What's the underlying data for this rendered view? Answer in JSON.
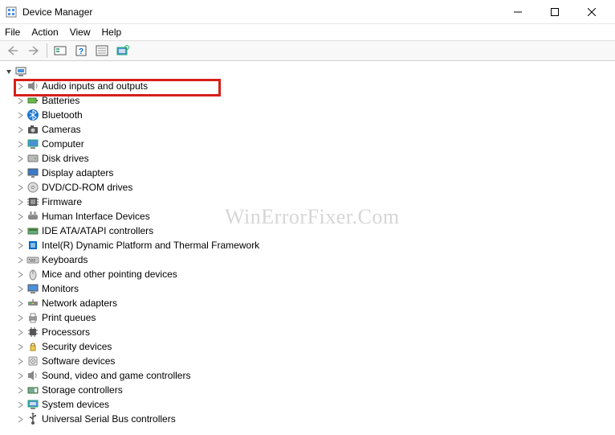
{
  "window": {
    "title": "Device Manager"
  },
  "menu": {
    "file": "File",
    "action": "Action",
    "view": "View",
    "help": "Help"
  },
  "toolbar": {
    "back": "back-icon",
    "forward": "forward-icon",
    "show_hidden": "show-hidden-icon",
    "help": "help-icon",
    "properties": "properties-icon",
    "scan": "scan-icon"
  },
  "root": {
    "label": ""
  },
  "categories": [
    {
      "label": "Audio inputs and outputs",
      "icon": "audio"
    },
    {
      "label": "Batteries",
      "icon": "battery"
    },
    {
      "label": "Bluetooth",
      "icon": "bluetooth"
    },
    {
      "label": "Cameras",
      "icon": "camera"
    },
    {
      "label": "Computer",
      "icon": "computer"
    },
    {
      "label": "Disk drives",
      "icon": "disk"
    },
    {
      "label": "Display adapters",
      "icon": "display"
    },
    {
      "label": "DVD/CD-ROM drives",
      "icon": "dvd"
    },
    {
      "label": "Firmware",
      "icon": "firmware"
    },
    {
      "label": "Human Interface Devices",
      "icon": "hid"
    },
    {
      "label": "IDE ATA/ATAPI controllers",
      "icon": "ide"
    },
    {
      "label": "Intel(R) Dynamic Platform and Thermal Framework",
      "icon": "intel"
    },
    {
      "label": "Keyboards",
      "icon": "keyboard"
    },
    {
      "label": "Mice and other pointing devices",
      "icon": "mouse"
    },
    {
      "label": "Monitors",
      "icon": "monitor"
    },
    {
      "label": "Network adapters",
      "icon": "network"
    },
    {
      "label": "Print queues",
      "icon": "printer"
    },
    {
      "label": "Processors",
      "icon": "cpu"
    },
    {
      "label": "Security devices",
      "icon": "security"
    },
    {
      "label": "Software devices",
      "icon": "software"
    },
    {
      "label": "Sound, video and game controllers",
      "icon": "sound"
    },
    {
      "label": "Storage controllers",
      "icon": "storage"
    },
    {
      "label": "System devices",
      "icon": "system"
    },
    {
      "label": "Universal Serial Bus controllers",
      "icon": "usb"
    }
  ],
  "highlight": {
    "category_index": 0
  },
  "watermark": "WinErrorFixer.Com"
}
